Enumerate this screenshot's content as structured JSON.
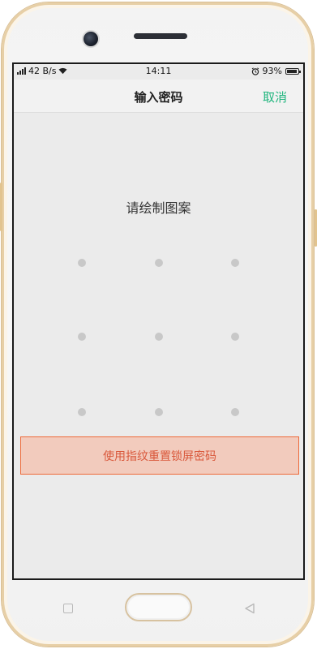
{
  "status_bar": {
    "network_speed": "42 B/s",
    "time": "14:11",
    "battery_percent": "93%",
    "battery_level": 0.93
  },
  "header": {
    "title": "输入密码",
    "cancel_label": "取消"
  },
  "main": {
    "prompt": "请绘制图案",
    "reset_label": "使用指纹重置锁屏密码"
  },
  "colors": {
    "accent_green": "#1fb57d",
    "reset_text": "#d9583b",
    "reset_border": "#ee6a3a",
    "reset_background": "#f2cbbd",
    "screen_background": "#ebebeb",
    "dot": "#c8c8c8"
  },
  "icons": {
    "signal": "signal-icon",
    "wifi": "wifi-icon",
    "alarm": "alarm-icon",
    "battery": "battery-icon",
    "recents": "square-icon",
    "back": "triangle-back-icon"
  }
}
